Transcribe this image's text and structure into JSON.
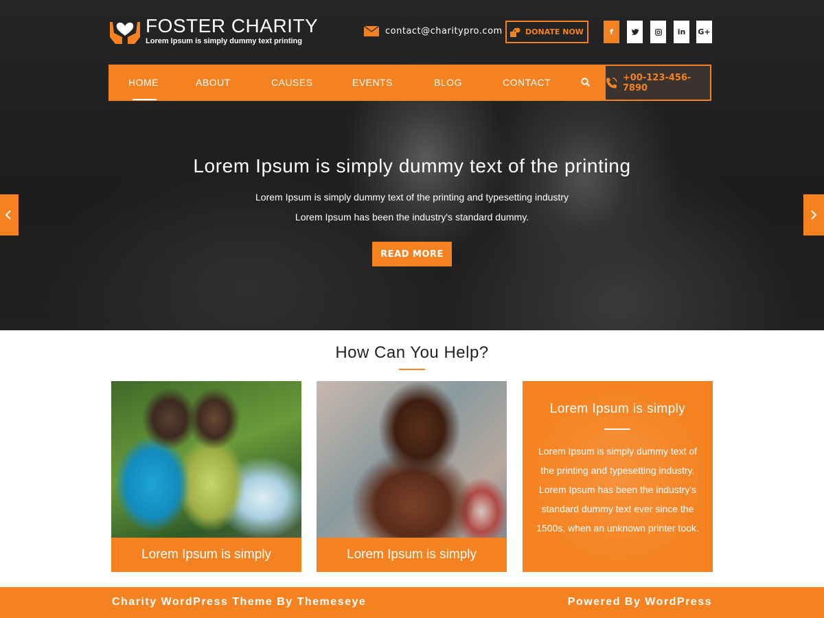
{
  "brand": {
    "title": "FOSTER CHARITY",
    "tagline": "Lorem Ipsum is simply dummy text printing"
  },
  "header": {
    "email": "contact@charitypro.com",
    "donate_label": "DONATE NOW",
    "social": [
      "f",
      "t",
      "ig",
      "in",
      "G+"
    ]
  },
  "nav": {
    "items": [
      "HOME",
      "ABOUT",
      "CAUSES",
      "EVENTS",
      "BLOG",
      "CONTACT"
    ],
    "active": "HOME",
    "phone": "+00-123-456-7890"
  },
  "hero": {
    "title": "Lorem Ipsum is simply dummy text of the printing",
    "line1": "Lorem Ipsum is simply dummy text of the printing and typesetting industry",
    "line2": "Lorem Ipsum has been the industry's standard dummy.",
    "button": "READ MORE"
  },
  "help": {
    "title": "How Can You Help?",
    "cards": [
      {
        "label": "Lorem Ipsum is simply"
      },
      {
        "label": "Lorem Ipsum is simply"
      },
      {
        "title": "Lorem Ipsum is simply",
        "text": "Lorem Ipsum is simply dummy text of the printing and typesetting industry. Lorem Ipsum has been the industry's standard dummy text ever since the 1500s, when an unknown printer took."
      }
    ]
  },
  "footer": {
    "left": "Charity WordPress Theme By Themeseye",
    "right": "Powered By WordPress"
  },
  "colors": {
    "accent": "#f58220",
    "dark": "#2c2c2c"
  }
}
